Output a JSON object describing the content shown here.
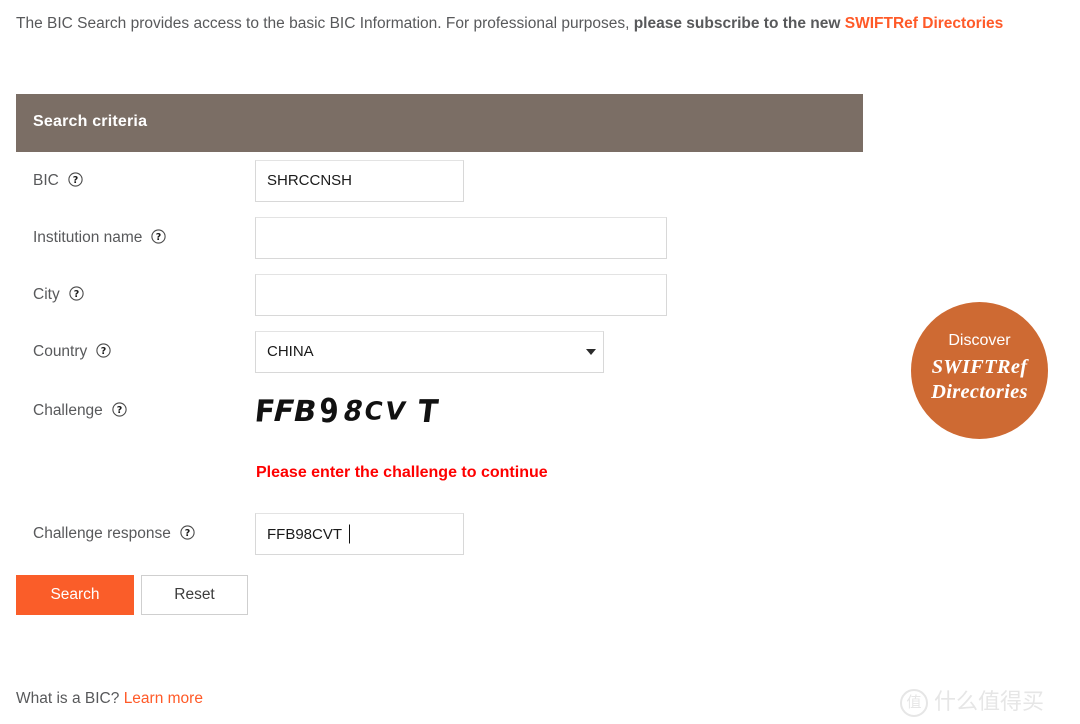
{
  "intro": {
    "text_normal": "The BIC Search provides access to the basic BIC Information. For professional purposes, ",
    "text_bold": "please subscribe to the new ",
    "link": "SWIFTRef Directories"
  },
  "panel": {
    "header_title": "Search criteria"
  },
  "form": {
    "help_icon": "help-circle-icon",
    "fields": [
      {
        "label": "BIC",
        "value": "SHRCCNSH",
        "placeholder": ""
      },
      {
        "label": "Institution name",
        "value": "",
        "placeholder": ""
      },
      {
        "label": "City",
        "value": "",
        "placeholder": ""
      },
      {
        "label": "Country",
        "value": "CHINA",
        "placeholder": ""
      },
      {
        "label": "Challenge",
        "value": "",
        "placeholder": ""
      },
      {
        "label": "Challenge response",
        "value": "FFB98CVT",
        "placeholder": ""
      }
    ],
    "country_options": [
      "CHINA"
    ],
    "captcha": {
      "text": "FFB98CV T",
      "chars": [
        "F",
        "F",
        "B",
        "9",
        "8",
        "C",
        "V",
        "T"
      ]
    },
    "error_message": "Please enter the challenge to continue"
  },
  "buttons": {
    "search": "Search",
    "reset": "Reset"
  },
  "footer": {
    "question": "What is a BIC?",
    "link": "Learn more"
  },
  "badge": {
    "line1": "Discover",
    "line2": "SWIFTRef",
    "line3": "Directories"
  },
  "watermark": {
    "mark": "值",
    "text": "什么值得买"
  },
  "colors": {
    "accent_orange": "#ff5a28",
    "button_orange": "#fa5d29",
    "header_brown": "#7b6e65",
    "badge_orange": "#ce6a33",
    "error_red": "#fe0000",
    "text_gray": "#58595b"
  }
}
